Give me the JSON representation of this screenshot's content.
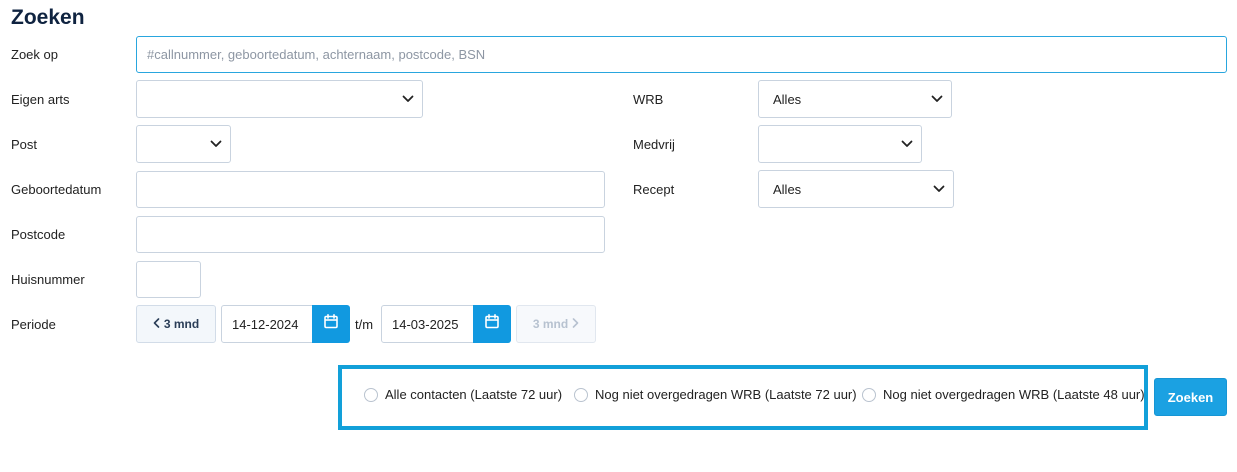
{
  "page": {
    "title": "Zoeken"
  },
  "form": {
    "search": {
      "label": "Zoek op",
      "placeholder": "#callnummer, geboortedatum, achternaam, postcode, BSN",
      "value": ""
    },
    "eigen_arts": {
      "label": "Eigen arts",
      "value": ""
    },
    "post": {
      "label": "Post",
      "value": ""
    },
    "geboortedatum": {
      "label": "Geboortedatum",
      "value": ""
    },
    "postcode": {
      "label": "Postcode",
      "value": ""
    },
    "huisnummer": {
      "label": "Huisnummer",
      "value": ""
    },
    "wrb": {
      "label": "WRB",
      "value": "Alles"
    },
    "medvrij": {
      "label": "Medvrij",
      "value": ""
    },
    "recept": {
      "label": "Recept",
      "value": "Alles"
    },
    "periode": {
      "label": "Periode",
      "prev_label": "3 mnd",
      "next_label": "3 mnd",
      "from": "14-12-2024",
      "to_sep": "t/m",
      "to": "14-03-2025"
    }
  },
  "filters": {
    "options": [
      {
        "label": "Alle contacten (Laatste 72 uur)",
        "checked": false
      },
      {
        "label": "Nog niet overgedragen WRB (Laatste 72 uur)",
        "checked": false
      },
      {
        "label": "Nog niet overgedragen WRB (Laatste 48 uur)",
        "checked": false
      }
    ]
  },
  "actions": {
    "submit_label": "Zoeken"
  },
  "colors": {
    "accent": "#1ba1e2",
    "highlight_border": "#12a0d9",
    "title": "#0f2340"
  },
  "icons": {
    "select_chevron": "chevron-down-icon",
    "calendar": "calendar-icon",
    "prev": "chevron-left-icon",
    "next": "chevron-right-icon"
  }
}
